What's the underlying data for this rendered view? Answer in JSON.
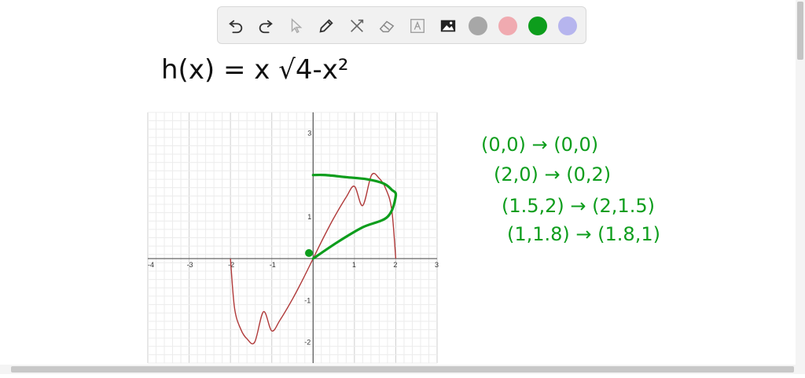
{
  "toolbar": {
    "tools": [
      "undo-icon",
      "redo-icon",
      "pointer-icon",
      "pen-icon",
      "tools-icon",
      "eraser-icon",
      "text-icon",
      "image-icon"
    ],
    "colors": [
      "#a7a7a7",
      "#f0aab0",
      "#0d9d1c",
      "#b6b5ee"
    ],
    "selected_color": "#0d9d1c"
  },
  "board": {
    "equation": "h(x) = x √4-x²",
    "notes": [
      "(0,0) → (0,0)",
      "(2,0) → (0,2)",
      "(1.5,2) → (2,1.5)",
      "(1,1.8) → (1.8,1)"
    ]
  },
  "chart_data": {
    "type": "line",
    "xlim": [
      -4,
      3
    ],
    "ylim": [
      -2.5,
      3.5
    ],
    "grid": true,
    "x_ticks": [
      "-4",
      "-3",
      "-2",
      "-1",
      "1",
      "2",
      "3"
    ],
    "y_ticks": [
      "3",
      "1",
      "-1",
      "-2"
    ],
    "series": [
      {
        "color": "#b03a3a",
        "x": [
          -2,
          -1.9,
          -1.75,
          -1.6,
          -1.414,
          -1.2,
          -1,
          -0.8,
          -0.5,
          -0.25,
          0,
          0.25,
          0.5,
          0.8,
          1,
          1.2,
          1.414,
          1.6,
          1.75,
          1.9,
          2
        ],
        "y": [
          0,
          -1.19,
          -1.69,
          -1.92,
          -2.0,
          -1.27,
          -1.73,
          -1.47,
          -0.97,
          -0.5,
          0,
          0.5,
          0.97,
          1.47,
          1.73,
          1.27,
          2.0,
          1.92,
          1.69,
          1.19,
          0
        ]
      },
      {
        "color": "#0d9d1c",
        "x": [
          0,
          0.6,
          1.2,
          1.8,
          2.0,
          1.9,
          1.7,
          1.3,
          0.8,
          0.3,
          0
        ],
        "y": [
          0,
          0.4,
          0.75,
          1.0,
          1.5,
          1.65,
          1.8,
          1.9,
          1.95,
          2.0,
          2.0
        ]
      }
    ]
  }
}
